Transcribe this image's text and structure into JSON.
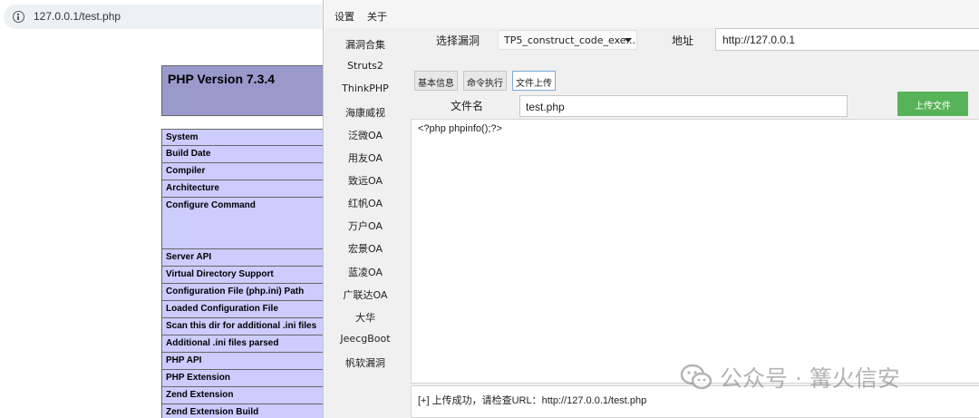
{
  "browser": {
    "url": "127.0.0.1/test.php"
  },
  "phpinfo": {
    "title": "PHP Version 7.3.4",
    "rows": [
      "System",
      "Build Date",
      "Compiler",
      "Architecture",
      "Configure Command",
      "Server API",
      "Virtual Directory Support",
      "Configuration File (php.ini) Path",
      "Loaded Configuration File",
      "Scan this dir for additional .ini files",
      "Additional .ini files parsed",
      "PHP API",
      "PHP Extension",
      "Zend Extension",
      "Zend Extension Build"
    ]
  },
  "tool": {
    "menu": [
      "设置",
      "关于"
    ],
    "sidebar": [
      "漏洞合集",
      "Struts2",
      "ThinkPHP",
      "海康威视",
      "泛微OA",
      "用友OA",
      "致远OA",
      "红帆OA",
      "万户OA",
      "宏景OA",
      "蓝凌OA",
      "广联达OA",
      "大华",
      "JeecgBoot",
      "帆软漏洞"
    ],
    "select_label": "选择漏洞",
    "selected_vuln": "TP5_construct_code_exe...",
    "address_label": "地址",
    "address_value": "http://127.0.0.1",
    "tabs": [
      "基本信息",
      "命令执行",
      "文件上传"
    ],
    "active_tab": "文件上传",
    "file_label": "文件名",
    "file_value": "test.php",
    "upload_button": "上传文件",
    "code": "<?php phpinfo();?>",
    "log": "[+] 上传成功，请检查URL：http://127.0.0.1/test.php"
  },
  "watermark": {
    "icon": "wechat-icon",
    "text": "公众号 · 篝火信安"
  },
  "colors": {
    "php_header": "#9999cc",
    "php_row": "#ccccff",
    "upload_button": "#57b35a"
  }
}
